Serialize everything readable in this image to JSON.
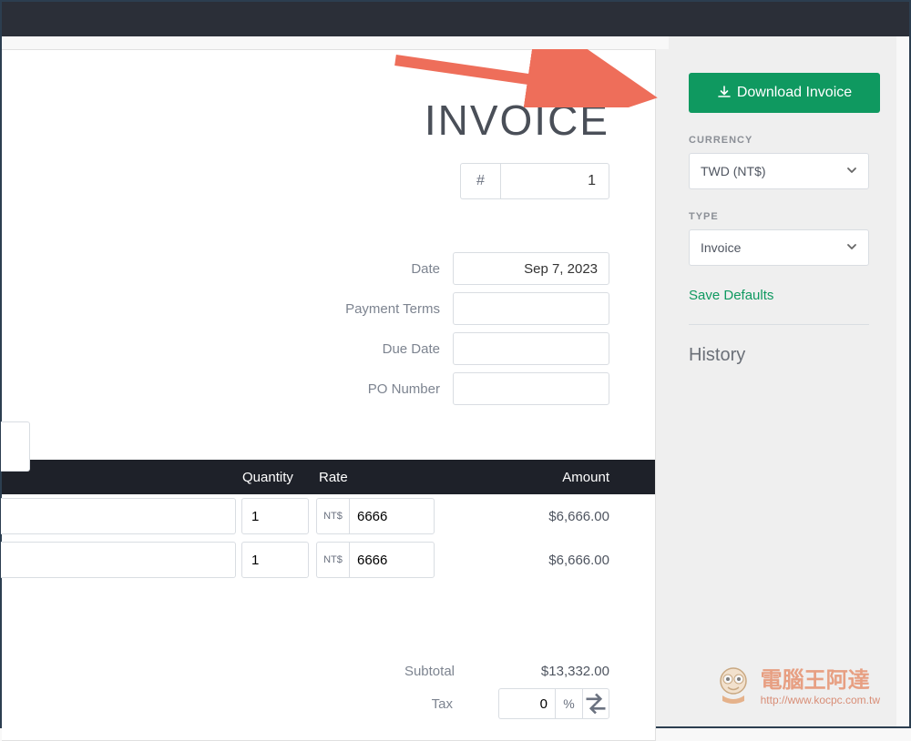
{
  "header": {
    "title": "INVOICE"
  },
  "invoice": {
    "number_prefix": "#",
    "number": "1",
    "fields": {
      "date_label": "Date",
      "date_value": "Sep 7, 2023",
      "payment_terms_label": "Payment Terms",
      "payment_terms_value": "",
      "due_date_label": "Due Date",
      "due_date_value": "",
      "po_number_label": "PO Number",
      "po_number_value": ""
    }
  },
  "table": {
    "columns": {
      "quantity": "Quantity",
      "rate": "Rate",
      "amount": "Amount"
    },
    "currency_prefix": "NT$",
    "rows": [
      {
        "qty": "1",
        "rate": "6666",
        "amount": "$6,666.00"
      },
      {
        "qty": "1",
        "rate": "6666",
        "amount": "$6,666.00"
      }
    ]
  },
  "totals": {
    "subtotal_label": "Subtotal",
    "subtotal_value": "$13,332.00",
    "tax_label": "Tax",
    "tax_value": "0",
    "tax_unit": "%"
  },
  "sidebar": {
    "download_label": "Download Invoice",
    "currency_label": "CURRENCY",
    "currency_value": "TWD (NT$)",
    "type_label": "TYPE",
    "type_value": "Invoice",
    "save_defaults_label": "Save Defaults",
    "history_label": "History"
  },
  "watermark": {
    "text": "電腦王阿達",
    "url": "http://www.kocpc.com.tw"
  }
}
